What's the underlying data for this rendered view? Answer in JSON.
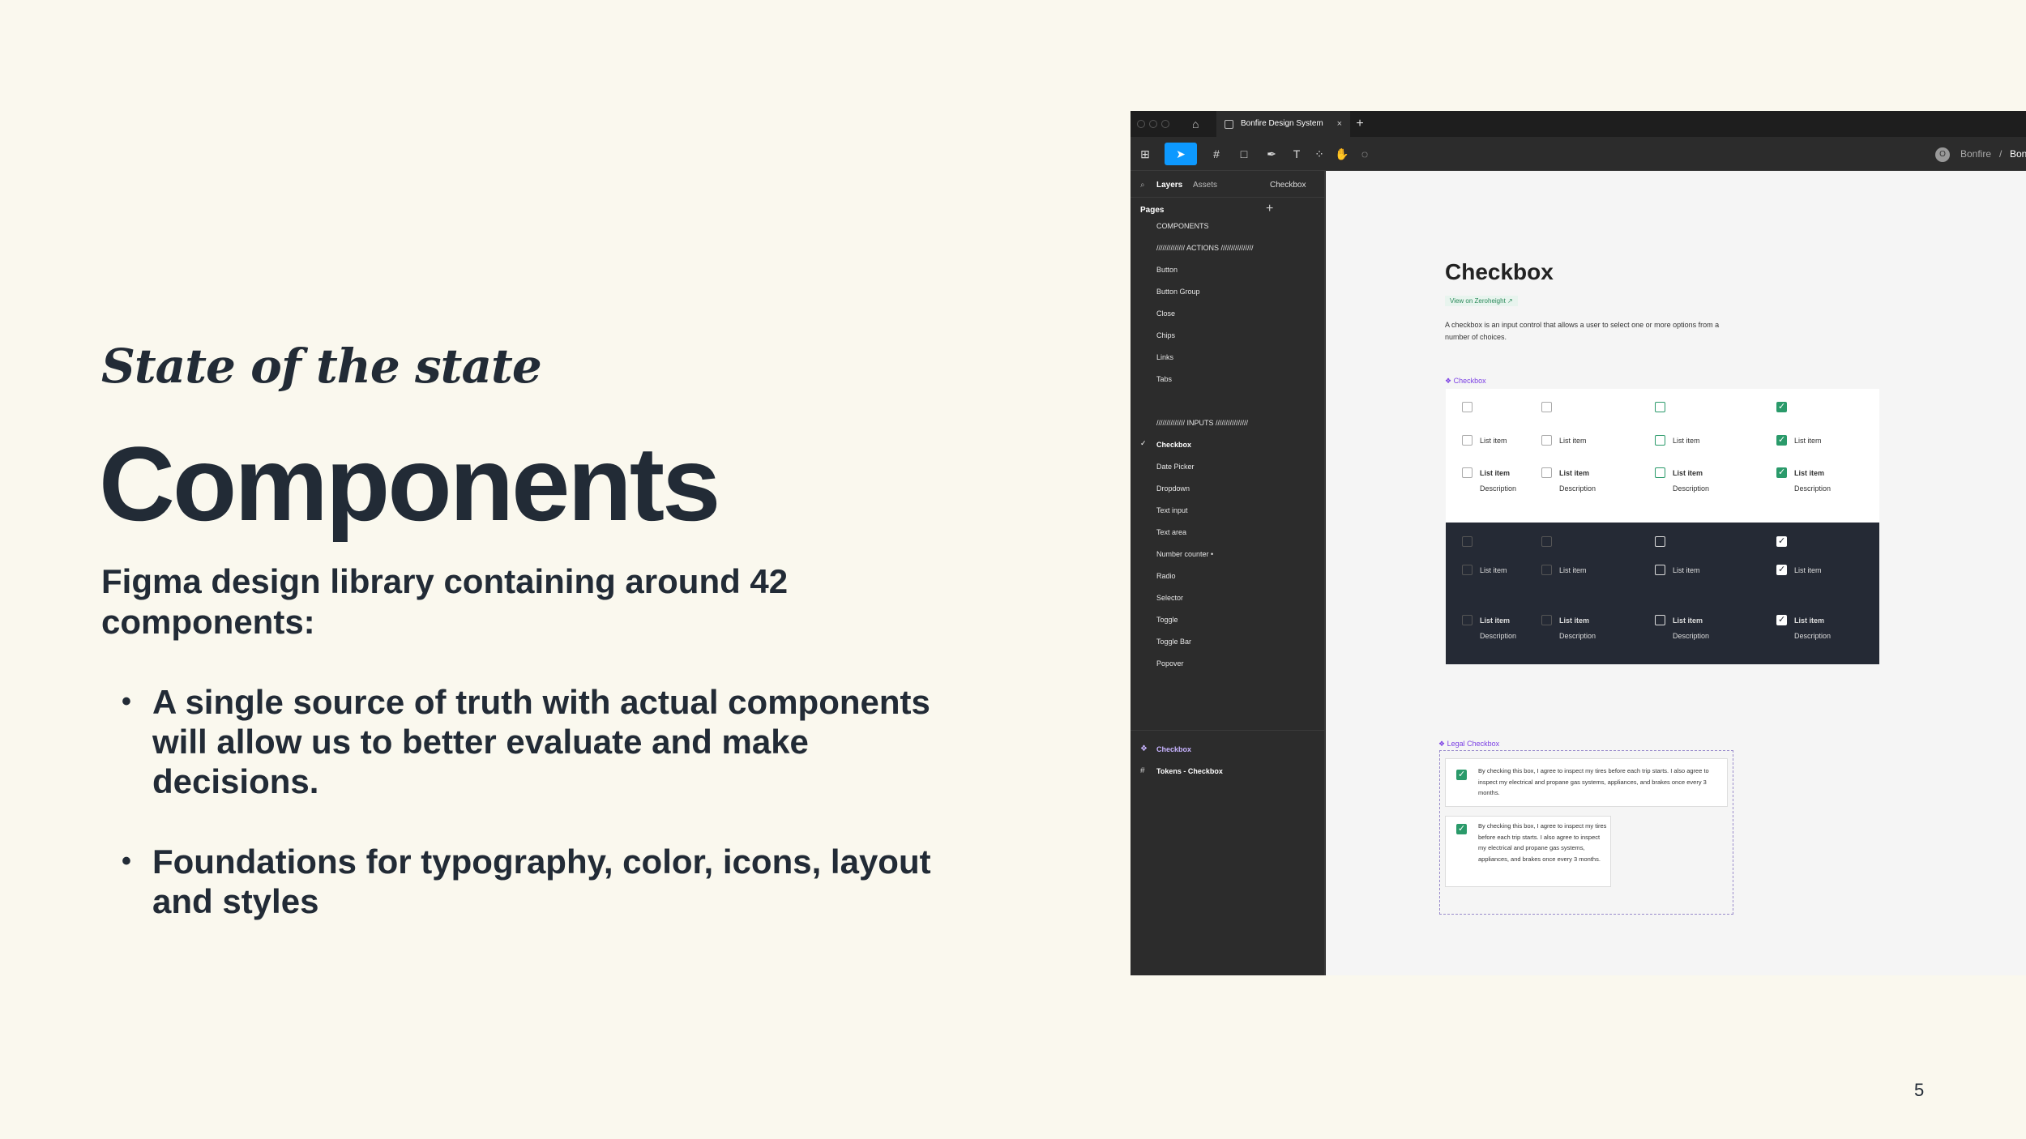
{
  "slide": {
    "subtitle": "State of the state",
    "title": "Components",
    "intro": "Figma design library containing around 42 components:",
    "bullets": [
      "A single source of truth with actual components will allow us to better evaluate and make decisions.",
      "Foundations for typography, color, icons, layout and styles"
    ],
    "bullet_char": "•",
    "page_number": "5"
  },
  "figma": {
    "tab_title": "Bonfire Design System",
    "tab_close": "×",
    "tab_plus": "+",
    "toolbar": {
      "avatar_initial": "O",
      "workspace": "Bonfire",
      "separator": "/",
      "file_short": "Bon"
    },
    "left_panel": {
      "layers_tab": "Layers",
      "assets_tab": "Assets",
      "current_page": "Checkbox",
      "pages_header": "Pages",
      "add": "+",
      "pages": [
        "COMPONENTS",
        "////////////// ACTIONS ////////////////",
        "Button",
        "Button Group",
        "Close",
        "Chips",
        "Links",
        "Tabs",
        "////////////// INPUTS ////////////////",
        "Checkbox",
        "Date Picker",
        "Dropdown",
        "Text input",
        "Text area",
        "Number counter •",
        "Radio",
        "Selector",
        "Toggle",
        "Toggle Bar",
        "Popover"
      ],
      "layers": [
        "Checkbox",
        "Tokens - Checkbox"
      ]
    },
    "canvas": {
      "title": "Checkbox",
      "link": "View on Zeroheight",
      "description": "A checkbox is an input control that allows a user to select one or more options from a number of choices.",
      "component_label": "Checkbox",
      "legal_label": "Legal Checkbox",
      "list_item": "List item",
      "description_label": "Description",
      "legal_text_1": "By checking this box, I agree to inspect my tires before each trip starts. I also agree to inspect my electrical and propane gas systems, appliances, and brakes once every 3 months.",
      "legal_text_2": "By checking this box, I agree to inspect my tires before each trip starts. I also agree to inspect my electrical and propane gas systems, appliances, and brakes once every 3 months."
    }
  }
}
